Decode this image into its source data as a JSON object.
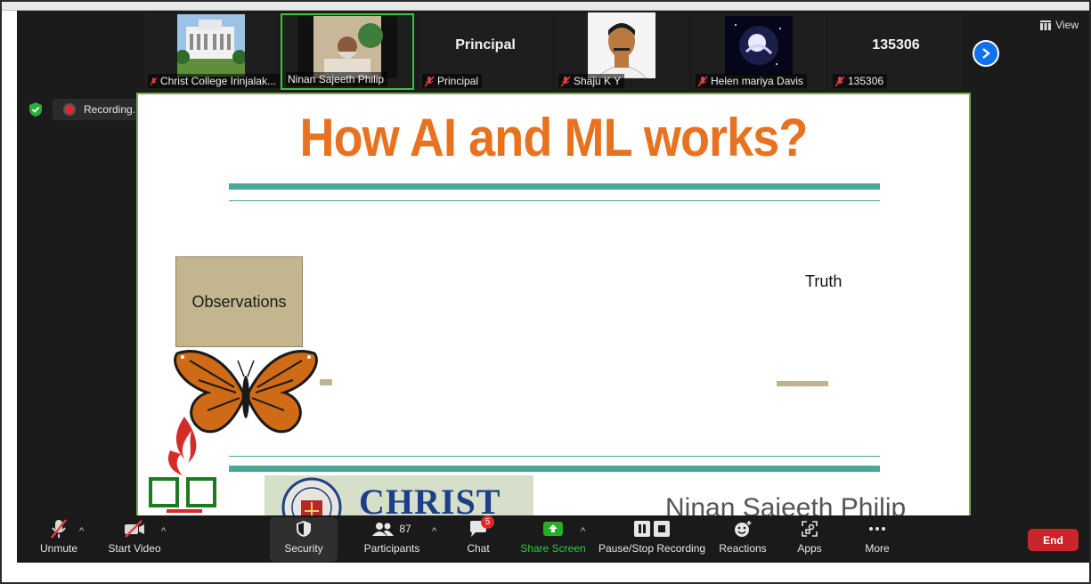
{
  "participants": [
    {
      "name": "Christ College Irinjalak...",
      "type": "photo"
    },
    {
      "name": "Ninan Sajeeth Philip",
      "type": "photo"
    },
    {
      "name": "Principal",
      "tile_text": "Principal",
      "type": "text"
    },
    {
      "name": "Shaju K Y",
      "type": "photo"
    },
    {
      "name": "Helen mariya Davis",
      "type": "photo"
    },
    {
      "name": "135306",
      "tile_text": "135306",
      "type": "text"
    }
  ],
  "view_label": "View",
  "recording": {
    "label": "Recording..."
  },
  "slide": {
    "title": "How AI and ML works?",
    "box_label": "Observations",
    "right_label": "Truth",
    "logo_text": "CHRIST",
    "presenter": "Ninan Sajeeth Philip",
    "colors": {
      "title": "#e8721f",
      "bar": "#49a89a",
      "box": "#c3b58d",
      "border": "#7aa84a"
    }
  },
  "toolbar": {
    "unmute": "Unmute",
    "start_video": "Start Video",
    "security": "Security",
    "participants": "Participants",
    "participants_count": "87",
    "chat": "Chat",
    "chat_badge": "5",
    "share_screen": "Share Screen",
    "pause_stop_recording": "Pause/Stop Recording",
    "reactions": "Reactions",
    "apps": "Apps",
    "more": "More",
    "end": "End"
  }
}
